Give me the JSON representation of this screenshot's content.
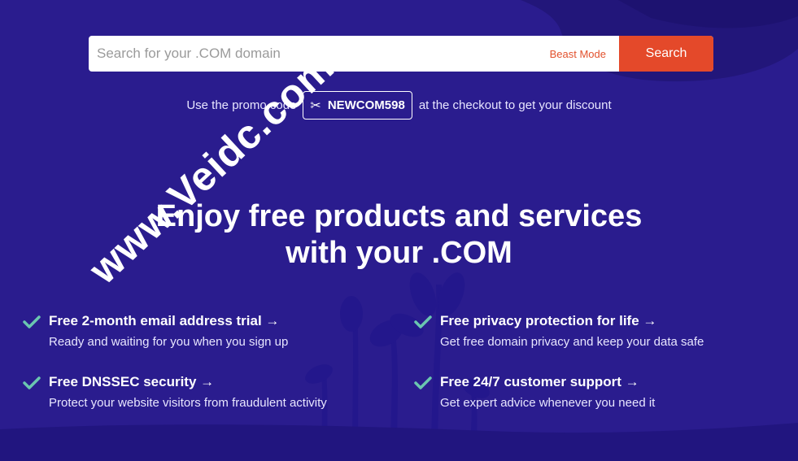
{
  "colors": {
    "background": "#2a1c8e",
    "accent": "#e4492a",
    "check": "#6ac6b0"
  },
  "search": {
    "placeholder": "Search for your .COM domain",
    "beast_mode_label": "Beast Mode",
    "button_label": "Search"
  },
  "promo": {
    "prefix": "Use the promo code",
    "icon": "scissors-icon",
    "code": "NEWCOM598",
    "suffix": "at the checkout to get your discount"
  },
  "headline": {
    "line1": "Enjoy free products and services",
    "line2": "with your .COM"
  },
  "features": [
    {
      "title": "Free 2-month email address trial →",
      "description": "Ready and waiting for you when you sign up",
      "icon": "check-icon"
    },
    {
      "title": "Free privacy protection for life →",
      "description": "Get free domain privacy and keep your data safe",
      "icon": "check-icon"
    },
    {
      "title": "Free DNSSEC security →",
      "description": "Protect your website visitors from fraudulent activity",
      "icon": "check-icon"
    },
    {
      "title": "Free 24/7 customer support →",
      "description": "Get expert advice whenever you need it",
      "icon": "check-icon"
    }
  ],
  "watermark": "www.Veidc.com"
}
